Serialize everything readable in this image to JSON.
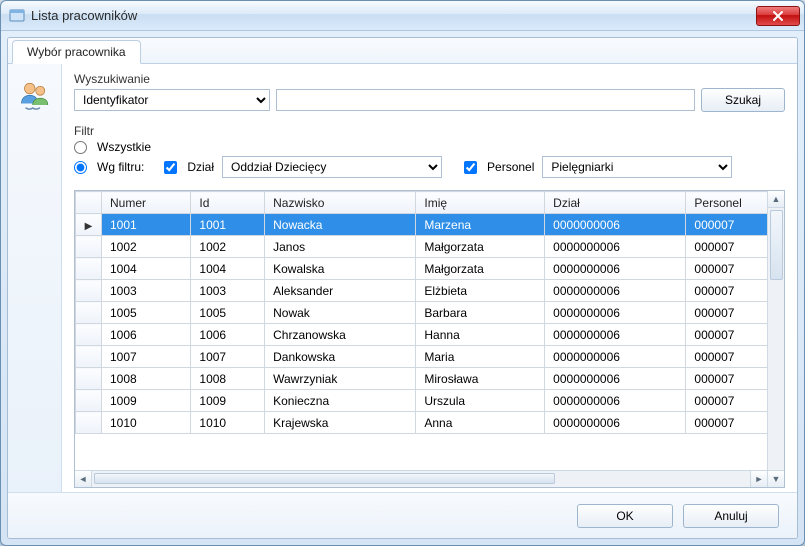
{
  "window": {
    "title": "Lista pracowników"
  },
  "tab": {
    "label": "Wybór pracownika"
  },
  "search": {
    "group_label": "Wyszukiwanie",
    "dropdown_value": "Identyfikator",
    "input_value": "",
    "button_label": "Szukaj"
  },
  "filter": {
    "group_label": "Filtr",
    "opt_all_label": "Wszystkie",
    "opt_by_label": "Wg filtru:",
    "selected_radio": "by",
    "dzial_checkbox_label": "Dział",
    "dzial_checked": true,
    "dzial_select_value": "Oddział Dziecięcy",
    "personel_checkbox_label": "Personel",
    "personel_checked": true,
    "personel_select_value": "Pielęgniarki"
  },
  "table": {
    "columns": [
      "Numer",
      "Id",
      "Nazwisko",
      "Imię",
      "Dział",
      "Personel"
    ],
    "selected_index": 0,
    "rows": [
      {
        "numer": "1001",
        "id": "1001",
        "nazwisko": "Nowacka",
        "imie": "Marzena",
        "dzial": "0000000006",
        "personel": "000007"
      },
      {
        "numer": "1002",
        "id": "1002",
        "nazwisko": "Janos",
        "imie": "Małgorzata",
        "dzial": "0000000006",
        "personel": "000007"
      },
      {
        "numer": "1004",
        "id": "1004",
        "nazwisko": "Kowalska",
        "imie": "Małgorzata",
        "dzial": "0000000006",
        "personel": "000007"
      },
      {
        "numer": "1003",
        "id": "1003",
        "nazwisko": "Aleksander",
        "imie": "Elżbieta",
        "dzial": "0000000006",
        "personel": "000007"
      },
      {
        "numer": "1005",
        "id": "1005",
        "nazwisko": "Nowak",
        "imie": "Barbara",
        "dzial": "0000000006",
        "personel": "000007"
      },
      {
        "numer": "1006",
        "id": "1006",
        "nazwisko": "Chrzanowska",
        "imie": "Hanna",
        "dzial": "0000000006",
        "personel": "000007"
      },
      {
        "numer": "1007",
        "id": "1007",
        "nazwisko": "Dankowska",
        "imie": "Maria",
        "dzial": "0000000006",
        "personel": "000007"
      },
      {
        "numer": "1008",
        "id": "1008",
        "nazwisko": "Wawrzyniak",
        "imie": "Mirosława",
        "dzial": "0000000006",
        "personel": "000007"
      },
      {
        "numer": "1009",
        "id": "1009",
        "nazwisko": "Konieczna",
        "imie": "Urszula",
        "dzial": "0000000006",
        "personel": "000007"
      },
      {
        "numer": "1010",
        "id": "1010",
        "nazwisko": "Krajewska",
        "imie": "Anna",
        "dzial": "0000000006",
        "personel": "000007"
      }
    ]
  },
  "footer": {
    "ok_label": "OK",
    "cancel_label": "Anuluj"
  }
}
